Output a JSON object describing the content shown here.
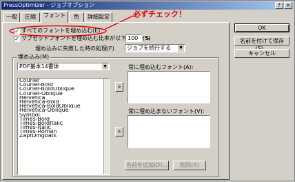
{
  "window": {
    "title": "PressOptimizer - ジョブオプション"
  },
  "tabs": [
    {
      "label": "一般"
    },
    {
      "label": "圧縮"
    },
    {
      "label": "フォント"
    },
    {
      "label": "色"
    },
    {
      "label": "詳細設定"
    }
  ],
  "active_tab": "フォント",
  "annotation": {
    "text": "必ずチェック！",
    "color": "#e60000"
  },
  "options": {
    "embed_all_label": "すべてのフォントを埋め込む(E)",
    "embed_all_checked": true,
    "subset_label": "サブセットフォントを埋め込む比率が以下の場合(S)",
    "subset_checked": true,
    "subset_value": "100",
    "subset_unit": "%",
    "on_fail_label": "埋め込みに失敗した時の処理(F)",
    "on_fail_value": "ジョブを続行する"
  },
  "embed_group": {
    "label": "埋め込み(M)",
    "source_select": "PDF基本14書体",
    "fonts": [
      "Courier",
      "Courier-Bold",
      "Courier-BoldOblique",
      "Courier-Oblique",
      "Helvetica",
      "Helvetica-Bold",
      "Helvetica-BoldOblique",
      "Helvetica-Oblique",
      "Symbol",
      "Times-Bold",
      "Times-BoldItalic",
      "Times-Italic",
      "Times-Roman",
      "ZapfDingbats"
    ],
    "always_embed_label": "常に埋め込むフォント(A):",
    "never_embed_label": "常に埋め込まないフォント(V):",
    "add_button": "名前を追加(D)...",
    "remove_button": "削除(R)"
  },
  "side_buttons": {
    "ok": "OK",
    "save": "名前を付けて保存(S)...",
    "cancel": "キャンセル"
  }
}
